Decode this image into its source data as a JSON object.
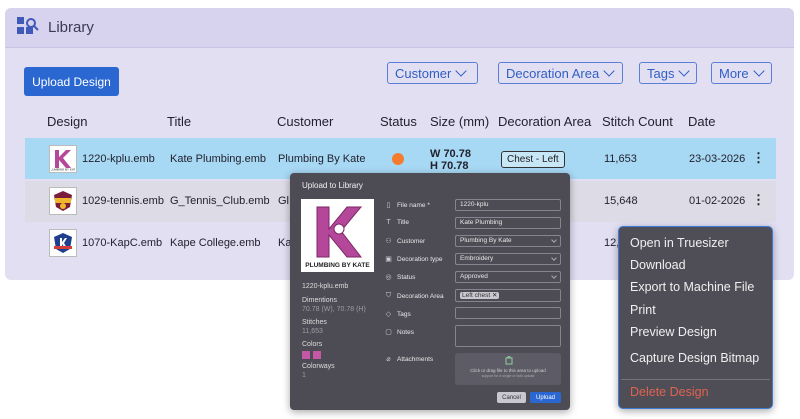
{
  "header": {
    "title": "Library",
    "icon": "library-icon"
  },
  "toolbar": {
    "upload_label": "Upload Design",
    "filters": [
      "Customer",
      "Decoration Area",
      "Tags",
      "More"
    ]
  },
  "table": {
    "columns": [
      "Design",
      "Title",
      "Customer",
      "Status",
      "Size (mm)",
      "Decoration Area",
      "Stitch Count",
      "Date"
    ],
    "rows": [
      {
        "design": "1220-kplu.emb",
        "title": "Kate Plumbing.emb",
        "customer": "Plumbing By Kate",
        "status": "orange",
        "size_w": "W 70.78",
        "size_h": "H 70.78",
        "area": "Chest - Left",
        "stitches": "11,653",
        "date": "23-03-2026"
      },
      {
        "design": "1029-tennis.emb",
        "title": "G_Tennis_Club.emb",
        "customer": "Gl",
        "stitches": "15,648",
        "date": "01-02-2026"
      },
      {
        "design": "1070-KapC.emb",
        "title": "Kape College.emb",
        "customer": "Ka",
        "stitches": "12,"
      }
    ]
  },
  "dialog": {
    "title": "Upload to Library",
    "preview_caption": "PLUMBING BY KATE",
    "filename": "1220-kplu.emb",
    "dimensions_label": "Dimentions",
    "dimensions_value": "70.78 (W), 70.78 (H)",
    "stitches_label": "Stitches",
    "stitches_value": "11,653",
    "colors_label": "Colors",
    "colorways_label": "Colorways",
    "colorways_value": "1",
    "fields": {
      "file_name_label": "File name *",
      "file_name_value": "1220-kplu",
      "title_label": "Title",
      "title_value": "Kate Plumbing",
      "customer_label": "Customer",
      "customer_value": "Plumbing By Kate",
      "decoration_type_label": "Decoration type",
      "decoration_type_value": "Embroidery",
      "status_label": "Status",
      "status_value": "Approved",
      "decoration_area_label": "Decoration Area",
      "decoration_area_value": "Left chest",
      "tags_label": "Tags",
      "notes_label": "Notes",
      "attachments_label": "Attachments",
      "dropzone_text": "Click or drag file to this area to upload",
      "dropzone_subtext": "support for a single or bulk upload"
    },
    "cancel_label": "Cancel",
    "upload_label": "Upload"
  },
  "context_menu": {
    "items": [
      "Open in Truesizer",
      "Download",
      "Export to Machine File",
      "Print",
      "Preview Design",
      "Capture Design Bitmap"
    ],
    "danger_item": "Delete Design"
  },
  "colors": {
    "accent": "#2b67d1",
    "status_orange": "#f47c2f",
    "swatch": "#c458a4",
    "danger": "#e0634f"
  }
}
